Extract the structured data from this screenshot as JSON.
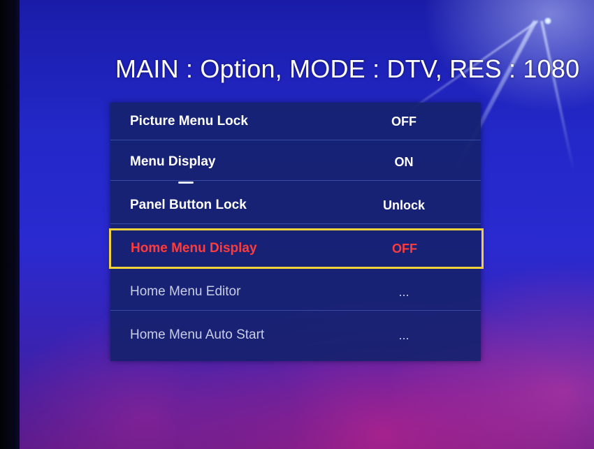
{
  "header": {
    "title": "MAIN : Option, MODE : DTV, RES : 1080"
  },
  "menu": {
    "items": [
      {
        "label": "Picture Menu Lock",
        "value": "OFF"
      },
      {
        "label": "Menu Display",
        "value": "ON"
      },
      {
        "label": "Panel Button Lock",
        "value": "Unlock"
      },
      {
        "label": "Home Menu Display",
        "value": "OFF"
      },
      {
        "label": "Home Menu Editor",
        "value": "..."
      },
      {
        "label": "Home Menu Auto Start",
        "value": "..."
      }
    ],
    "selected_index": 3
  },
  "colors": {
    "menu_background": "#16226e",
    "selected_text": "#ff3b3b",
    "selection_border": "#f2d23a",
    "normal_text": "#ffffff",
    "dim_text": "#c8cde6"
  }
}
